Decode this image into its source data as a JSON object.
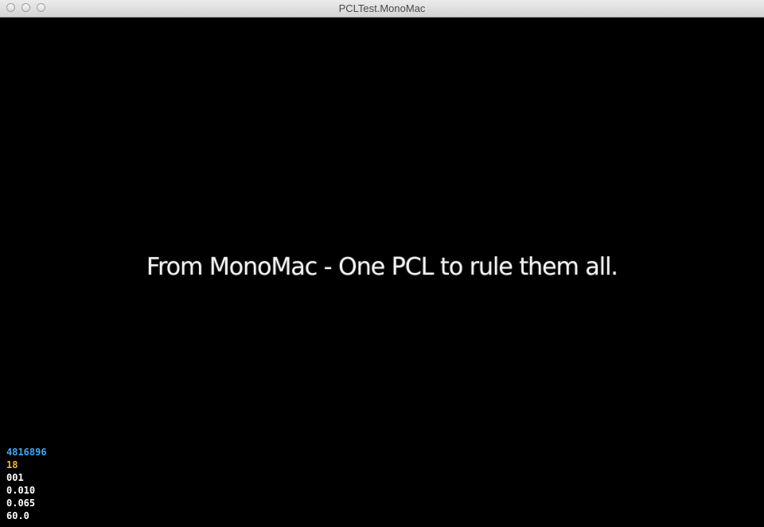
{
  "window": {
    "title": "PCLTest.MonoMac"
  },
  "main": {
    "headline": "From MonoMac - One PCL to rule them all."
  },
  "stats": [
    {
      "value": "4816896",
      "color": "#3fa9f5"
    },
    {
      "value": "18",
      "color": "#f5b82e"
    },
    {
      "value": "001",
      "color": "#ffffff"
    },
    {
      "value": "0.010",
      "color": "#ffffff"
    },
    {
      "value": "0.065",
      "color": "#ffffff"
    },
    {
      "value": "60.0",
      "color": "#ffffff"
    }
  ],
  "colors": {
    "background": "#000000",
    "headline": "#f2f2f2"
  }
}
